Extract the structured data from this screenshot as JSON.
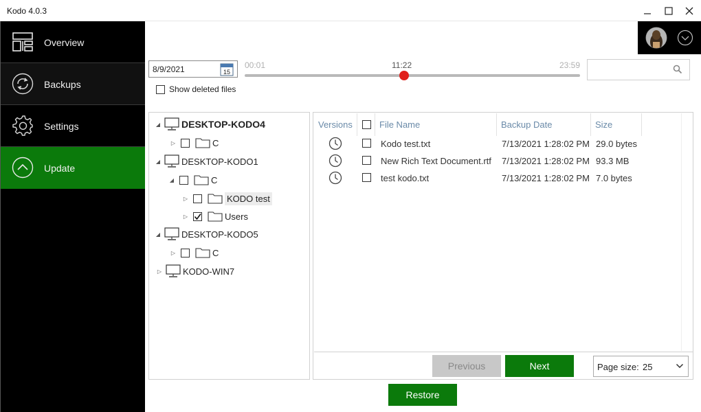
{
  "window": {
    "title": "Kodo 4.0.3"
  },
  "sidebar": {
    "items": [
      {
        "label": "Overview",
        "icon": "dashboard-icon"
      },
      {
        "label": "Backups",
        "icon": "backup-refresh-icon"
      },
      {
        "label": "Settings",
        "icon": "gear-icon"
      },
      {
        "label": "Update",
        "icon": "chevron-up-circle-icon",
        "active": true
      }
    ]
  },
  "toolbar": {
    "date": "8/9/2021",
    "calendar_day": "15",
    "timeline": {
      "start": "00:01",
      "current": "11:22",
      "end": "23:59",
      "position_fraction": 0.475
    },
    "search_placeholder": "",
    "show_deleted_label": "Show deleted files",
    "show_deleted_checked": false
  },
  "tree": {
    "nodes": [
      {
        "label": "DESKTOP-KODO4",
        "bold": true
      },
      {
        "label": "C"
      },
      {
        "label": "DESKTOP-KODO1"
      },
      {
        "label": "C"
      },
      {
        "label": "KODO test"
      },
      {
        "label": "Users",
        "checked": true
      },
      {
        "label": "DESKTOP-KODO5"
      },
      {
        "label": "C"
      },
      {
        "label": "KODO-WIN7"
      }
    ]
  },
  "grid": {
    "columns": [
      "Versions",
      "File Name",
      "Backup Date",
      "Size"
    ],
    "rows": [
      {
        "file_name": "Kodo test.txt",
        "backup_date": "7/13/2021 1:28:02 PM",
        "size": "29.0 bytes"
      },
      {
        "file_name": "New Rich Text Document.rtf",
        "backup_date": "7/13/2021 1:28:02 PM",
        "size": "93.3 MB"
      },
      {
        "file_name": "test kodo.txt",
        "backup_date": "7/13/2021 1:28:02 PM",
        "size": "7.0 bytes"
      }
    ],
    "pagination": {
      "previous_label": "Previous",
      "next_label": "Next",
      "page_size_label": "Page size:",
      "page_size_value": "25"
    }
  },
  "restore_label": "Restore",
  "colors": {
    "accent": "#0b7a0b",
    "sidebar_bg": "#000000",
    "timeline_knob": "#e0201b"
  }
}
